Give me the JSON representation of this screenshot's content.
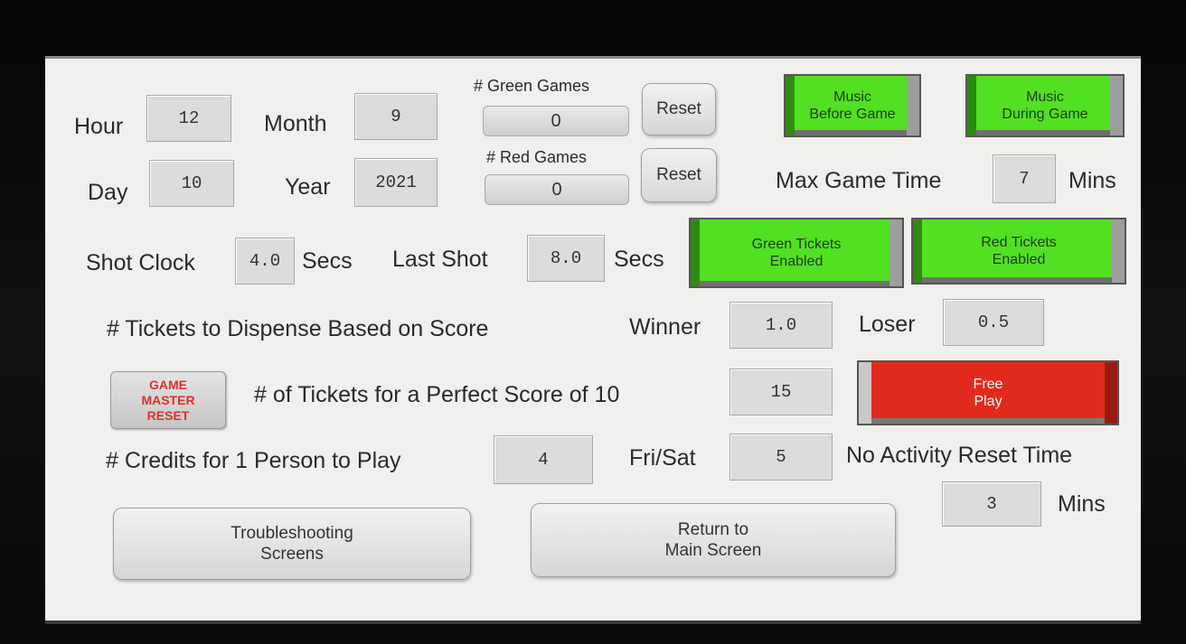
{
  "labels": {
    "hour": "Hour",
    "month": "Month",
    "day": "Day",
    "year": "Year",
    "green_games": "# Green Games",
    "red_games": "# Red Games",
    "max_game_time": "Max Game Time",
    "max_game_time_unit": "Mins",
    "shot_clock": "Shot Clock",
    "shot_clock_unit": "Secs",
    "last_shot": "Last Shot",
    "last_shot_unit": "Secs",
    "tickets_dispense": "# Tickets to Dispense Based on Score",
    "winner": "Winner",
    "loser": "Loser",
    "perfect_score": "# of Tickets for a Perfect Score of 10",
    "credits": "# Credits for 1 Person to Play",
    "fri_sat": "Fri/Sat",
    "no_activity": "No Activity Reset Time",
    "no_activity_unit": "Mins"
  },
  "values": {
    "hour": "12",
    "month": "9",
    "day": "10",
    "year": "2021",
    "green_games": "0",
    "red_games": "0",
    "max_game_time": "7",
    "shot_clock": "4.0",
    "last_shot": "8.0",
    "winner": "1.0",
    "loser": "0.5",
    "perfect_score": "15",
    "credits": "4",
    "fri_sat": "5",
    "no_activity": "3"
  },
  "buttons": {
    "reset_green": "Reset",
    "reset_red": "Reset",
    "music_before": [
      "Music",
      "Before Game"
    ],
    "music_during": [
      "Music",
      "During Game"
    ],
    "green_tickets": [
      "Green Tickets",
      "Enabled"
    ],
    "red_tickets": [
      "Red Tickets",
      "Enabled"
    ],
    "free_play": [
      "Free",
      "Play"
    ],
    "game_master_reset": [
      "GAME",
      "MASTER",
      "RESET"
    ],
    "troubleshooting": [
      "Troubleshooting",
      "Screens"
    ],
    "return_main": [
      "Return to",
      "Main Screen"
    ]
  },
  "colors": {
    "enabled_green": "#52e022",
    "free_play_red": "#e22a1c",
    "game_master_text": "#e03030"
  }
}
